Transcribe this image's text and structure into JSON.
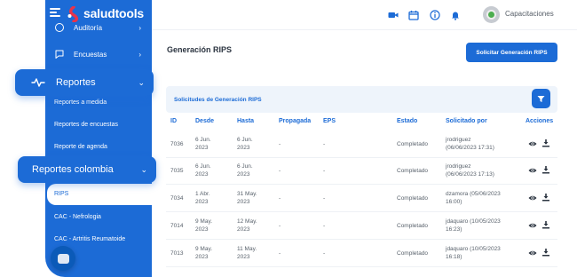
{
  "brand": {
    "name": "saludtools"
  },
  "sidebar": {
    "items": [
      {
        "label": "Auditoría",
        "icon": "shield-icon"
      },
      {
        "label": "Encuestas",
        "icon": "chat-survey-icon"
      }
    ],
    "reportes": {
      "label": "Reportes",
      "icon": "pulse-icon"
    },
    "reportes_sub": [
      "Reportes a medida",
      "Reportes de encuestas",
      "Reporte de agenda"
    ],
    "reportes_colombia": {
      "label": "Reportes colombia"
    },
    "colombia_sub": [
      "RIPS",
      "CAC - Nefrologia",
      "CAC - Artritis Reumatoide"
    ],
    "active_sub": "RIPS"
  },
  "topbar": {
    "icons": [
      "video-icon",
      "calendar-icon",
      "info-icon",
      "bell-icon"
    ],
    "user": "Capacitaciones"
  },
  "page": {
    "title": "Generación RIPS",
    "primary_button": "Solicitar Generación RIPS",
    "card_title": "Solicitudes de Generación RIPS"
  },
  "table": {
    "headers": [
      "ID",
      "Desde",
      "Hasta",
      "Propagada",
      "EPS",
      "Estado",
      "Solicitado por",
      "Acciones"
    ],
    "rows": [
      {
        "id": "7036",
        "desde": [
          "6 Jun.",
          "2023"
        ],
        "hasta": [
          "6 Jun.",
          "2023"
        ],
        "propagada": "-",
        "eps": "-",
        "estado": "Completado",
        "por": [
          "jrodriguez",
          "(06/06/2023 17:31)"
        ]
      },
      {
        "id": "7035",
        "desde": [
          "6 Jun.",
          "2023"
        ],
        "hasta": [
          "6 Jun.",
          "2023"
        ],
        "propagada": "-",
        "eps": "-",
        "estado": "Completado",
        "por": [
          "jrodriguez",
          "(06/06/2023 17:13)"
        ]
      },
      {
        "id": "7034",
        "desde": [
          "1 Abr.",
          "2023"
        ],
        "hasta": [
          "31 May.",
          "2023"
        ],
        "propagada": "-",
        "eps": "-",
        "estado": "Completado",
        "por": [
          "dzamora (05/06/2023",
          "16:00)"
        ]
      },
      {
        "id": "7014",
        "desde": [
          "9 May.",
          "2023"
        ],
        "hasta": [
          "12 May.",
          "2023"
        ],
        "propagada": "-",
        "eps": "-",
        "estado": "Completado",
        "por": [
          "jdaquaro (10/05/2023",
          "16:23)"
        ]
      },
      {
        "id": "7013",
        "desde": [
          "9 May.",
          "2023"
        ],
        "hasta": [
          "11 May.",
          "2023"
        ],
        "propagada": "-",
        "eps": "-",
        "estado": "Completado",
        "por": [
          "jdaquaro (10/05/2023",
          "16:18)"
        ]
      }
    ]
  },
  "colors": {
    "primary": "#1c6bd6",
    "card_bg": "#eef4fb",
    "text": "#2b3440",
    "muted": "#59626c",
    "logo_red": "#e8334a"
  }
}
